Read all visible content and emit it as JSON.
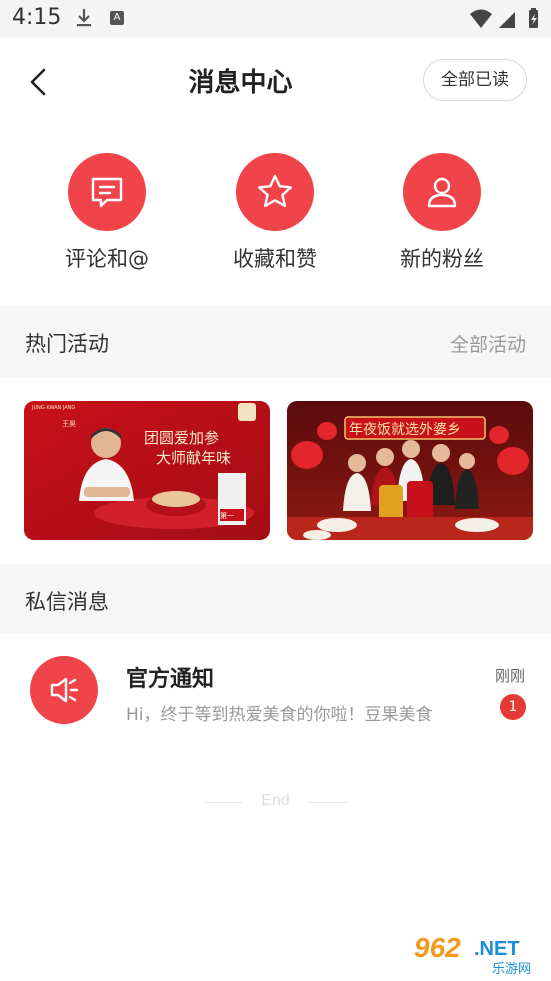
{
  "status_bar": {
    "time": "4:15",
    "icons": [
      "download-icon",
      "a-icon",
      "wifi-icon",
      "signal-icon",
      "battery-icon"
    ]
  },
  "header": {
    "title": "消息中心",
    "mark_all_read": "全部已读"
  },
  "quick_entries": [
    {
      "label": "评论和@",
      "icon": "comment-icon"
    },
    {
      "label": "收藏和赞",
      "icon": "star-icon"
    },
    {
      "label": "新的粉丝",
      "icon": "person-icon"
    }
  ],
  "hot_activities": {
    "title": "热门活动",
    "all_link": "全部活动",
    "banners": [
      {
        "brand": "JUNG KWAN JANG",
        "name": "王昊",
        "line1": "团圆爱加参",
        "line2": "大师献年味",
        "tag": "第一"
      },
      {
        "slogan": "年夜饭就选外婆乡"
      }
    ]
  },
  "private_messages": {
    "title": "私信消息",
    "items": [
      {
        "title": "官方通知",
        "preview": "Hi，终于等到热爱美食的你啦！豆果美食",
        "time": "刚刚",
        "unread": "1",
        "icon": "megaphone-icon"
      }
    ]
  },
  "end_text": "End",
  "watermark": {
    "main": "962.NET",
    "sub": "乐游网"
  },
  "colors": {
    "accent": "#f0444a",
    "badge": "#e53935",
    "section_bg": "#f6f6f6"
  }
}
